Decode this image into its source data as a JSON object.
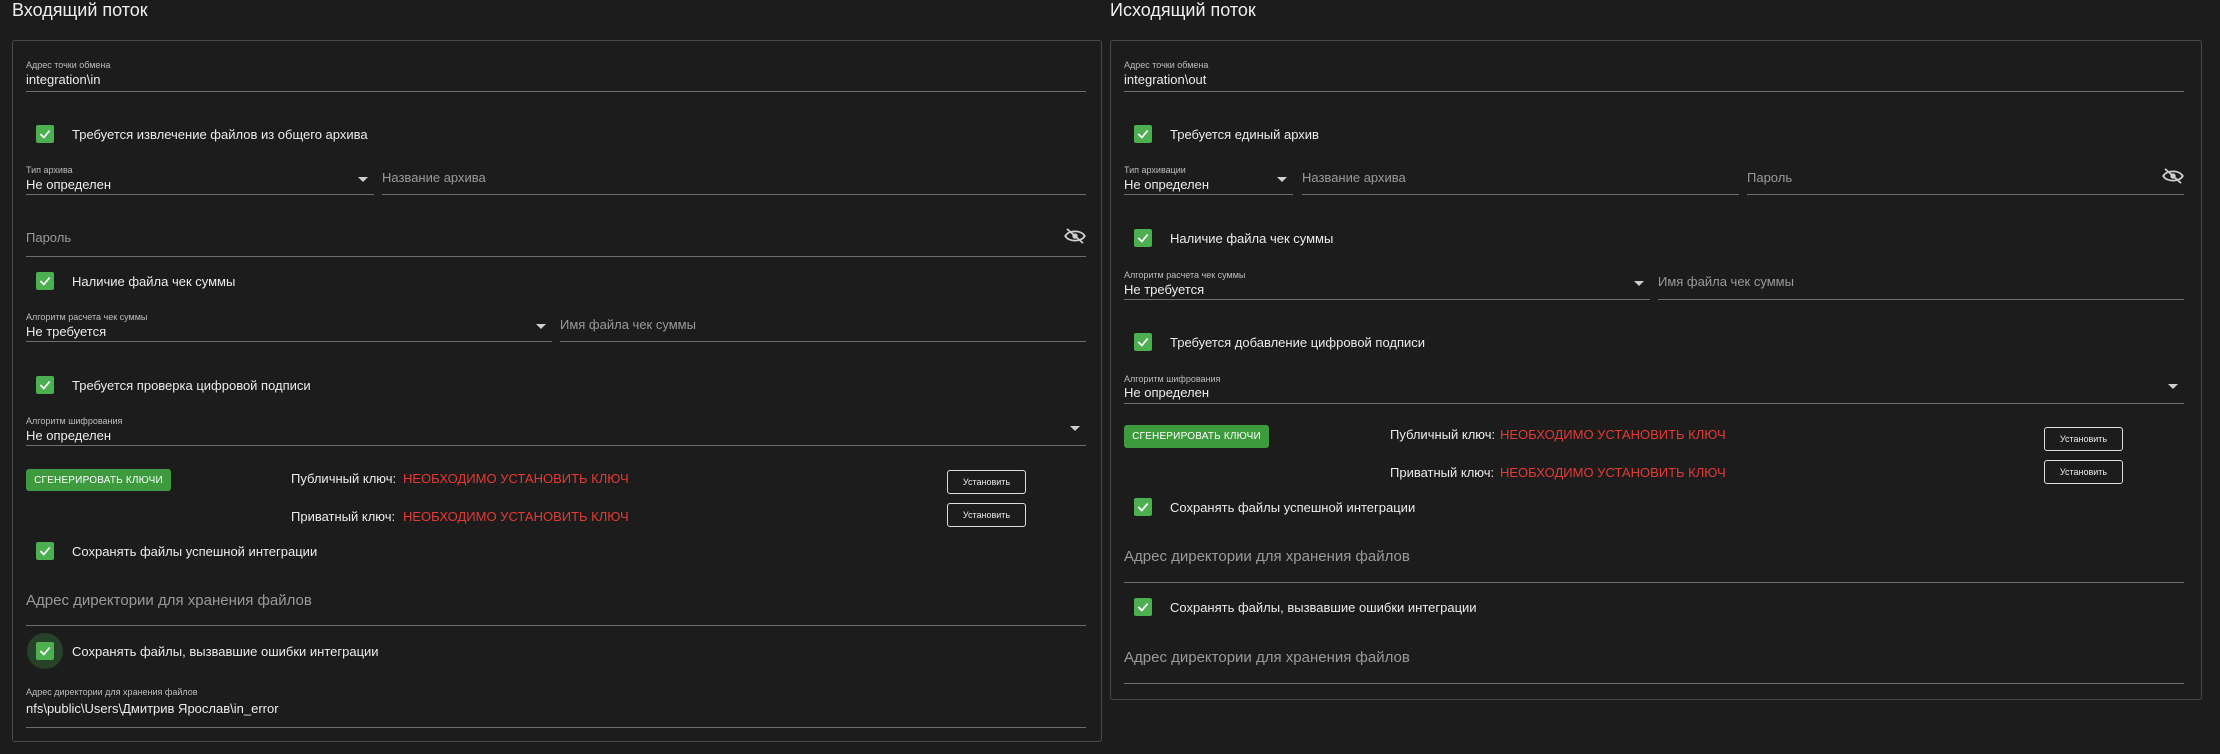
{
  "incoming": {
    "title": "Входящий поток",
    "exchange_address": {
      "label": "Адрес точки обмена",
      "value": "integration\\in"
    },
    "extract_archive": {
      "label": "Требуется извлечение файлов из общего архива",
      "checked": true
    },
    "archive_type": {
      "label": "Тип архива",
      "value": "Не определен"
    },
    "archive_name": {
      "placeholder": "Название архива"
    },
    "password": {
      "placeholder": "Пароль"
    },
    "checksum_file": {
      "label": "Наличие файла чек суммы",
      "checked": true
    },
    "checksum_algo": {
      "label": "Алгоритм расчета чек суммы",
      "value": "Не требуется"
    },
    "checksum_filename": {
      "placeholder": "Имя файла чек суммы"
    },
    "verify_signature": {
      "label": "Требуется проверка цифровой подписи",
      "checked": true
    },
    "encryption_algo": {
      "label": "Алгоритм шифрования",
      "value": "Не определен"
    },
    "generate_keys_label": "СГЕНЕРИРОВАТЬ КЛЮЧИ",
    "public_key_label": "Публичный ключ:",
    "public_key_value": "НЕОБХОДИМО УСТАНОВИТЬ КЛЮЧ",
    "private_key_label": "Приватный ключ:",
    "private_key_value": "НЕОБХОДИМО УСТАНОВИТЬ КЛЮЧ",
    "set_label": "Установить",
    "save_success": {
      "label": "Сохранять файлы успешной интеграции",
      "checked": true
    },
    "success_dir": {
      "placeholder": "Адрес директории для хранения файлов"
    },
    "save_errors": {
      "label": "Сохранять файлы, вызвавшие ошибки интеграции",
      "checked": true
    },
    "error_dir": {
      "label": "Адрес директории для хранения файлов",
      "value": "nfs\\public\\Users\\Дмитрив Ярослав\\in_error"
    }
  },
  "outgoing": {
    "title": "Исходящий поток",
    "exchange_address": {
      "label": "Адрес точки обмена",
      "value": "integration\\out"
    },
    "single_archive": {
      "label": "Требуется единый архив",
      "checked": true
    },
    "archive_type": {
      "label": "Тип архивации",
      "value": "Не определен"
    },
    "archive_name": {
      "placeholder": "Название архива"
    },
    "password": {
      "placeholder": "Пароль"
    },
    "checksum_file": {
      "label": "Наличие файла чек суммы",
      "checked": true
    },
    "checksum_algo": {
      "label": "Алгоритм расчета чек суммы",
      "value": "Не требуется"
    },
    "checksum_filename": {
      "placeholder": "Имя файла чек суммы"
    },
    "add_signature": {
      "label": "Требуется добавление цифровой подписи",
      "checked": true
    },
    "encryption_algo": {
      "label": "Алгоритм шифрования",
      "value": "Не определен"
    },
    "generate_keys_label": "СГЕНЕРИРОВАТЬ КЛЮЧИ",
    "public_key_label": "Публичный ключ:",
    "public_key_value": "НЕОБХОДИМО УСТАНОВИТЬ КЛЮЧ",
    "private_key_label": "Приватный ключ:",
    "private_key_value": "НЕОБХОДИМО УСТАНОВИТЬ КЛЮЧ",
    "set_label": "Установить",
    "save_success": {
      "label": "Сохранять файлы успешной интеграции",
      "checked": true
    },
    "success_dir": {
      "placeholder": "Адрес директории для хранения файлов"
    },
    "save_errors": {
      "label": "Сохранять файлы, вызвавшие ошибки интеграции",
      "checked": true
    },
    "error_dir": {
      "placeholder": "Адрес директории для хранения файлов"
    }
  },
  "icons": {
    "check": "check-icon",
    "eye_off": "eye-off-icon",
    "dropdown": "arrow-drop-down-icon"
  },
  "colors": {
    "accent": "#4caf50",
    "warning": "#e53935",
    "background": "#1c1c1c"
  }
}
